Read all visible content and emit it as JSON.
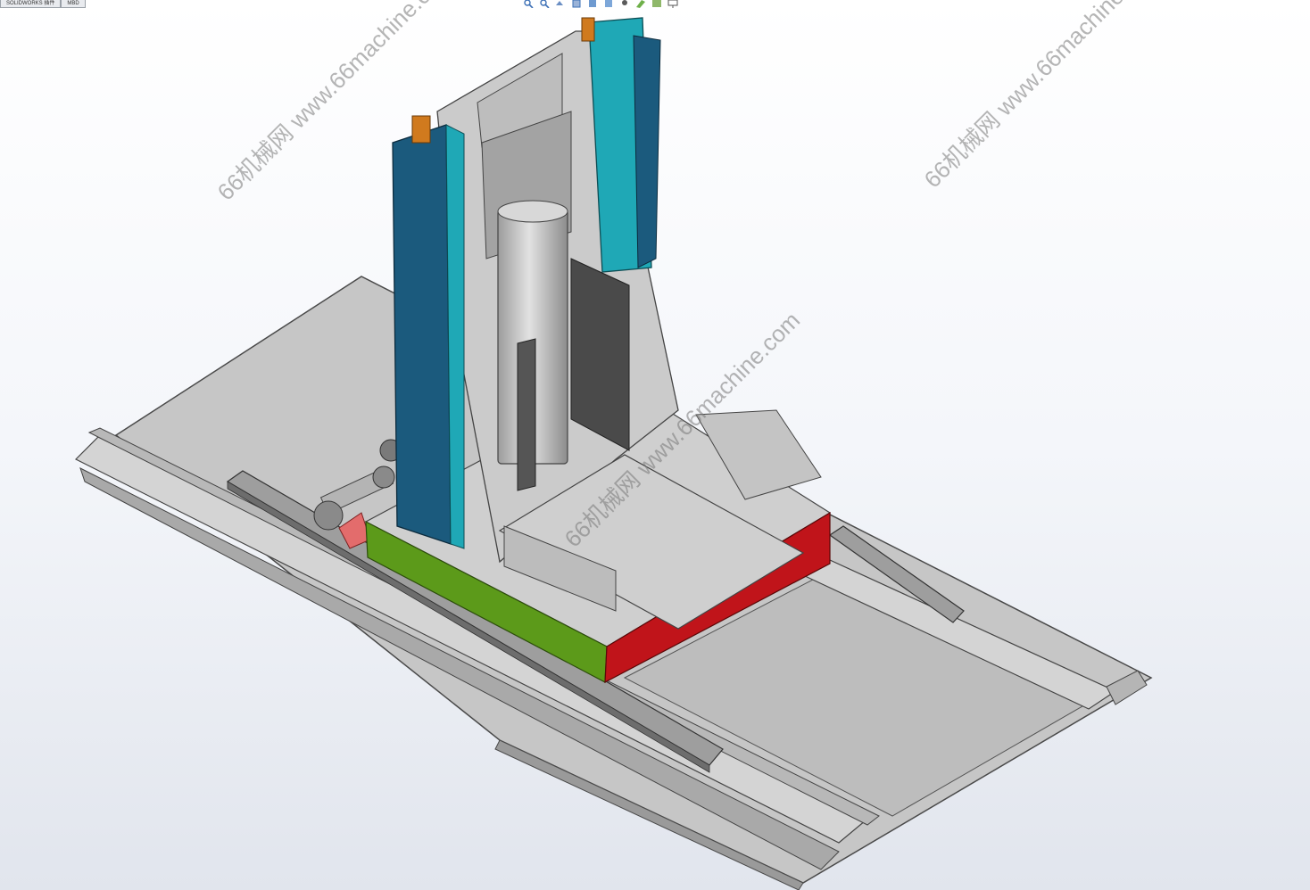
{
  "toolbar_tabs": [
    {
      "label": "SOLIDWORKS 插件"
    },
    {
      "label": "MBD"
    }
  ],
  "hud_icons": [
    "zoom-to-fit-icon",
    "zoom-area-icon",
    "previous-view-icon",
    "section-view-icon",
    "view-orientation-icon",
    "display-style-icon",
    "hide-show-icon",
    "edit-appearance-icon",
    "apply-scene-icon",
    "view-settings-icon"
  ],
  "watermark": {
    "text": "66机械网 www.66machine.com"
  },
  "colors": {
    "rail_blue": "#1b5a7d",
    "rail_cyan": "#1fa8b6",
    "green_plate": "#5a9a1a",
    "red_plate": "#c0141a",
    "steel": "#c9c9c9",
    "orange": "#d07a1e"
  }
}
